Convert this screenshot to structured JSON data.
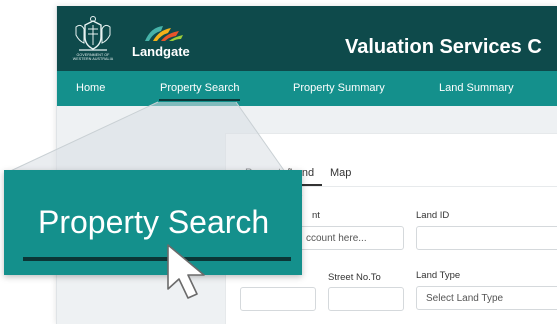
{
  "header": {
    "crest_caption": "GOVERNMENT OF WESTERN AUSTRALIA",
    "brand_name": "Landgate",
    "brand_colors": [
      "#f2b11b",
      "#e8542a",
      "#46b3a9",
      "#1f6e6b"
    ],
    "app_title": "Valuation Services C"
  },
  "nav": {
    "items": [
      {
        "label": "Home"
      },
      {
        "label": "Property Search"
      },
      {
        "label": "Property Summary"
      },
      {
        "label": "Land Summary"
      }
    ],
    "active": "Property Search"
  },
  "panel": {
    "tabs": [
      {
        "label": "Property/Land"
      },
      {
        "label": "Map"
      }
    ],
    "fields": {
      "account_label": "nt",
      "account_placeholder": "ccount here...",
      "land_id_label": "Land ID",
      "street_no_to_label": "Street No.To",
      "land_type_label": "Land Type",
      "land_type_placeholder": "Select Land Type"
    }
  },
  "callout": {
    "label": "Property Search"
  },
  "colors": {
    "header_bg": "#0e4a4b",
    "nav_bg": "#14908c",
    "underline": "#0b3939",
    "page_bg": "#eef1f3"
  }
}
